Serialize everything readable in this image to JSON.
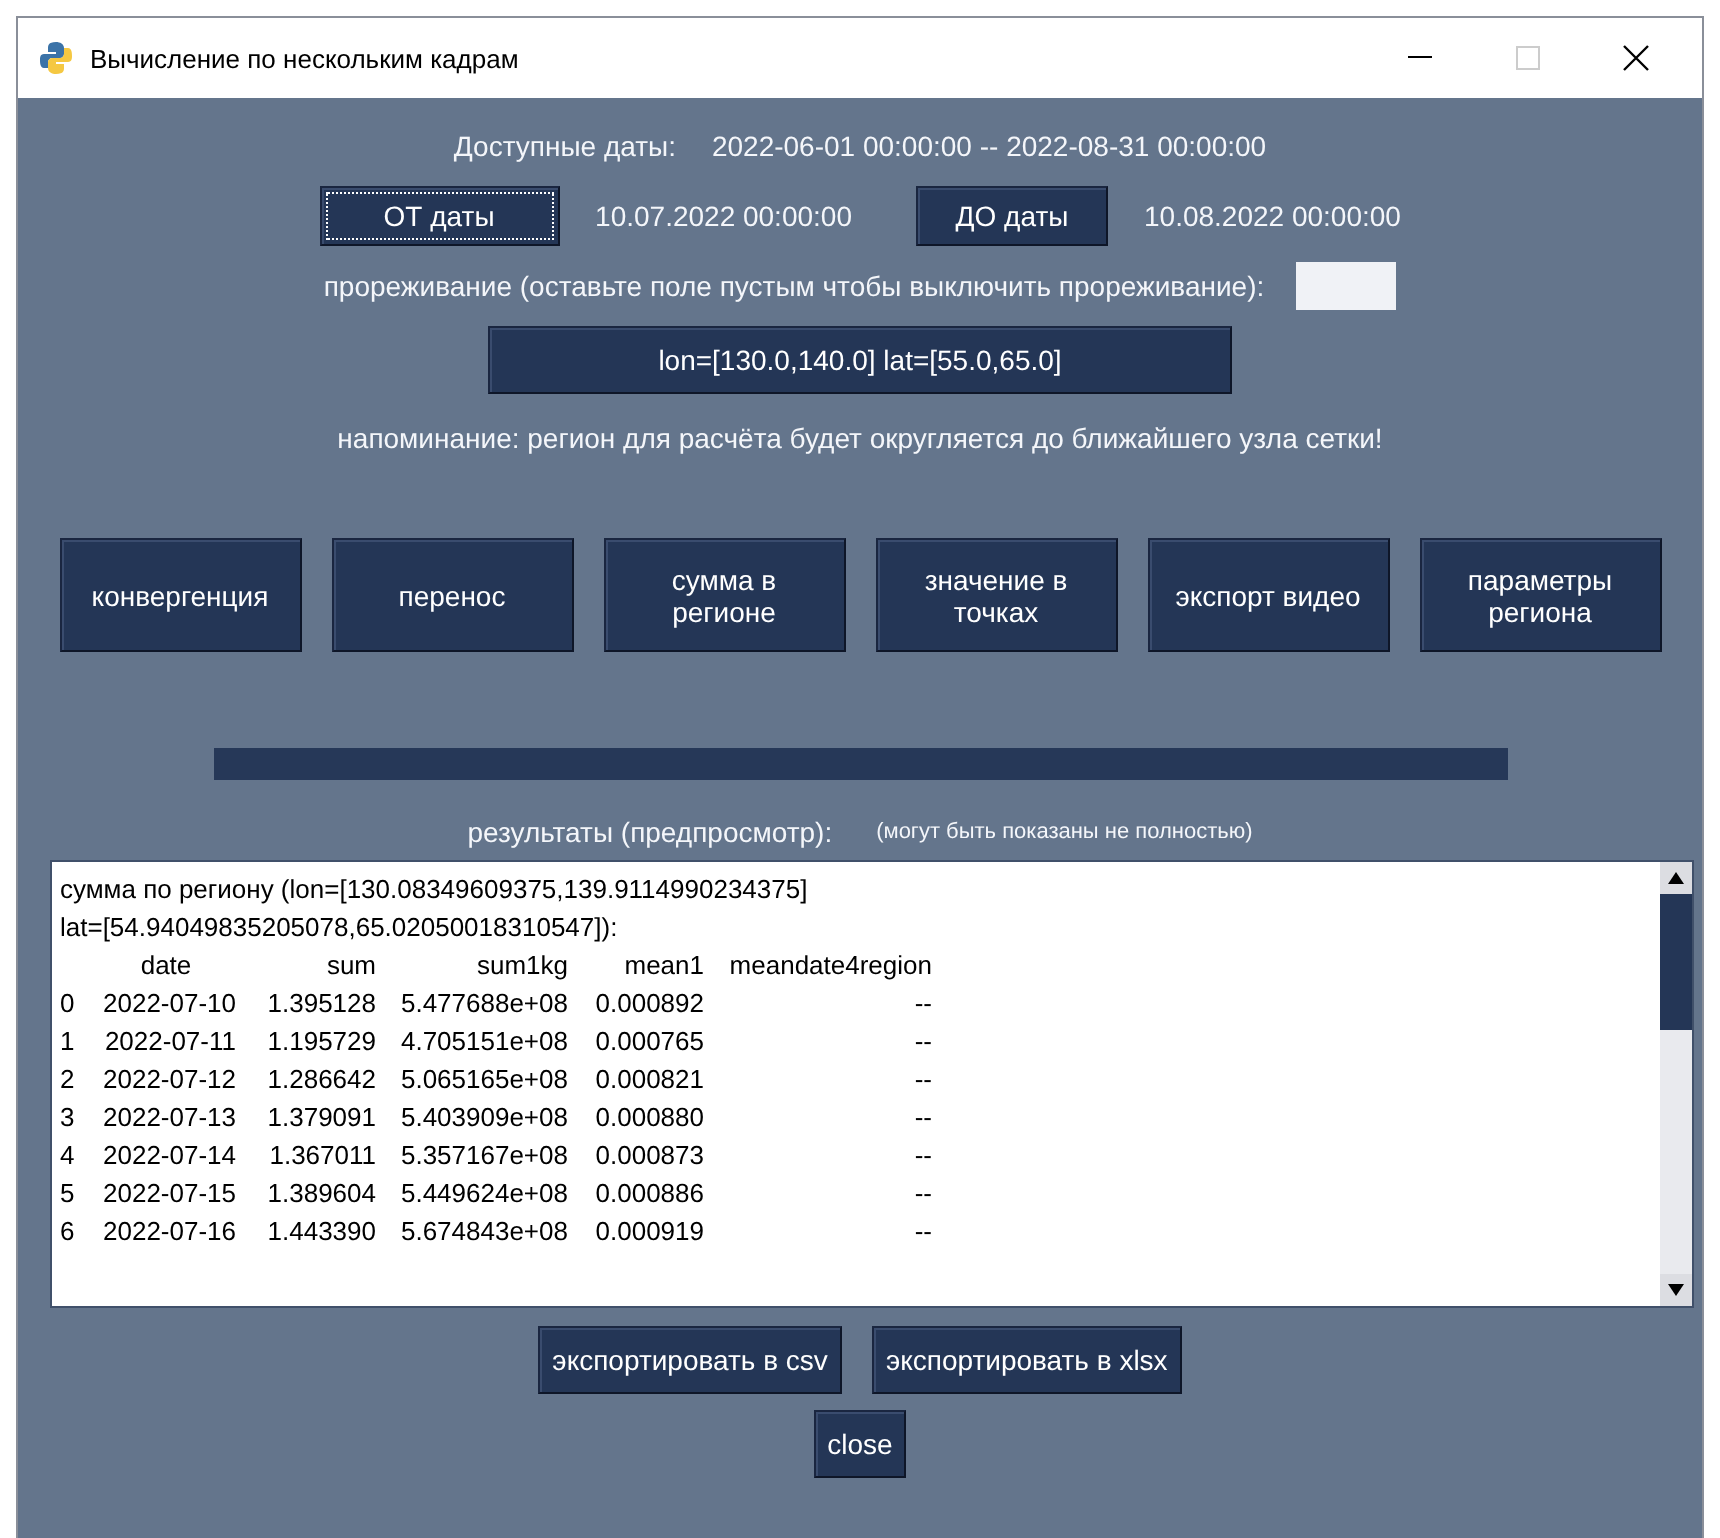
{
  "window": {
    "title": "Вычисление по нескольким кадрам"
  },
  "available": {
    "label": "Доступные даты:",
    "range": "2022-06-01 00:00:00 -- 2022-08-31 00:00:00"
  },
  "date_from": {
    "button": "ОТ даты",
    "value": "10.07.2022 00:00:00",
    "focused": true
  },
  "date_to": {
    "button": "ДО даты",
    "value": "10.08.2022 00:00:00",
    "focused": false
  },
  "thinning": {
    "label": "прореживание (оставьте поле пустым чтобы выключить прореживание):"
  },
  "region_button": "lon=[130.0,140.0] lat=[55.0,65.0]",
  "progress": {
    "level": 1
  },
  "reminder": "напоминание: регион для расчёта будет округляется до ближайшего узла сетки!",
  "actions": [
    "конвергенция",
    "перенос",
    "сумма в регионе",
    "значение в точках",
    "экспорт видео",
    "параметры региона"
  ],
  "results": {
    "label": "результаты (предпросмотр):",
    "note": "(могут быть показаны не полностью)",
    "header_lines": [
      "сумма по региону (lon=[130.08349609375,139.9114990234375]",
      "lat=[54.94049835205078,65.02050018310547]):"
    ],
    "columns": [
      "",
      "date",
      "sum",
      "sum1kg",
      "mean1",
      "meandate4region"
    ],
    "rows": [
      [
        "0",
        "2022-07-10",
        "1.395128",
        "5.477688e+08",
        "0.000892",
        "--"
      ],
      [
        "1",
        "2022-07-11",
        "1.195729",
        "4.705151e+08",
        "0.000765",
        "--"
      ],
      [
        "2",
        "2022-07-12",
        "1.286642",
        "5.065165e+08",
        "0.000821",
        "--"
      ],
      [
        "3",
        "2022-07-13",
        "1.379091",
        "5.403909e+08",
        "0.000880",
        "--"
      ],
      [
        "4",
        "2022-07-14",
        "1.367011",
        "5.357167e+08",
        "0.000873",
        "--"
      ],
      [
        "5",
        "2022-07-15",
        "1.389604",
        "5.449624e+08",
        "0.000886",
        "--"
      ],
      [
        "6",
        "2022-07-16",
        "1.443390",
        "5.674843e+08",
        "0.000919",
        "--"
      ]
    ]
  },
  "export_buttons": [
    "экспортировать в csv",
    "экспортировать в xlsx"
  ],
  "close_button": "close"
}
